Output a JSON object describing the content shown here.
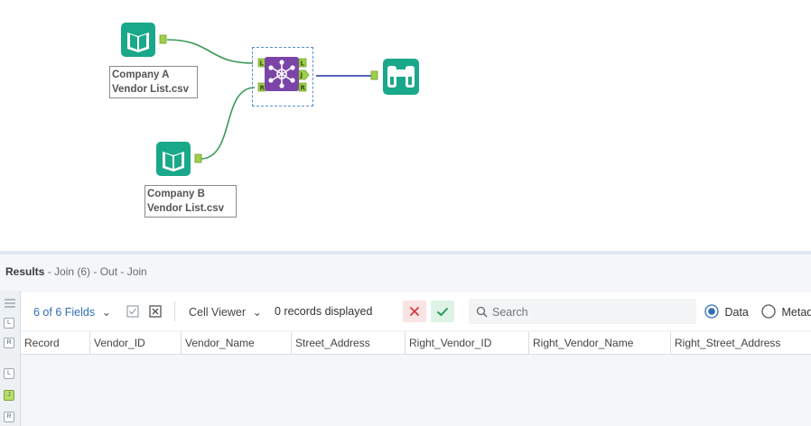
{
  "canvas": {
    "tools": [
      {
        "type": "input",
        "caption": "Company A\nVendor List.csv"
      },
      {
        "type": "input",
        "caption": "Company B\nVendor List.csv"
      },
      {
        "type": "join",
        "anchors": {
          "left": "L",
          "right": "R",
          "out_left": "L",
          "out_join": "J",
          "out_right": "R"
        }
      },
      {
        "type": "browse"
      }
    ],
    "colors": {
      "tool_teal": "#1aa88a",
      "join_purple": "#7b45a8",
      "wire_green": "#3a9a55",
      "wire_blue": "#3c4fb3",
      "anchor_green": "#9fd04a"
    }
  },
  "results": {
    "title_bold": "Results",
    "title_rest": " - Join (6) - Out - Join",
    "fields_label": "6 of 6 Fields",
    "cell_viewer_label": "Cell Viewer",
    "records_label": "0 records displayed",
    "search_placeholder": "Search",
    "view_data_label": "Data",
    "view_metadata_label": "Metadata",
    "side_icons": [
      "L",
      "R",
      "L",
      "J",
      "R"
    ],
    "columns": [
      "Record",
      "Vendor_ID",
      "Vendor_Name",
      "Street_Address",
      "Right_Vendor_ID",
      "Right_Vendor_Name",
      "Right_Street_Address"
    ]
  }
}
